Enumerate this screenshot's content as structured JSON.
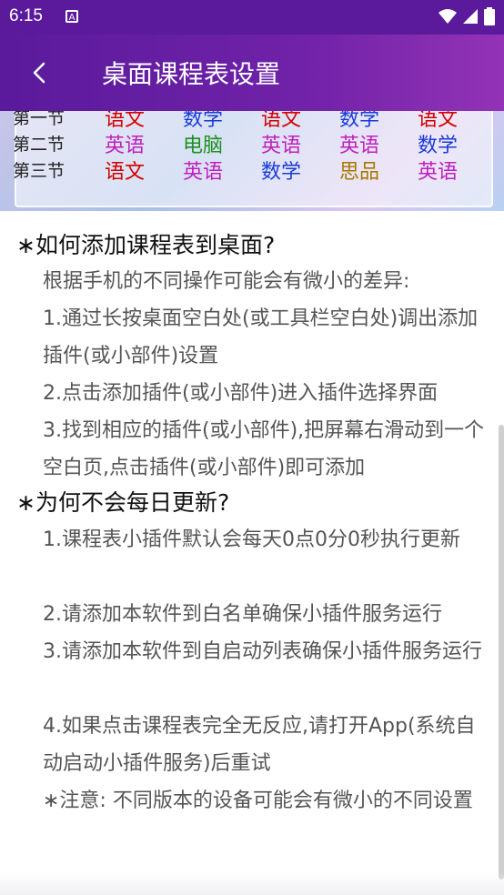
{
  "status_bar": {
    "time": "6:15",
    "notification_icon": "A",
    "wifi_icon": "wifi-icon",
    "signal_icon": "signal-icon",
    "battery_icon": "battery-icon"
  },
  "app_bar": {
    "title": "桌面课程表设置",
    "back_icon": "chevron-left-icon"
  },
  "preview": {
    "rows": [
      {
        "period": "第一节",
        "cells": [
          {
            "text": "语文",
            "color": "#d40000"
          },
          {
            "text": "数学",
            "color": "#1a3ad8"
          },
          {
            "text": "语文",
            "color": "#d40000"
          },
          {
            "text": "数学",
            "color": "#1a3ad8"
          },
          {
            "text": "语文",
            "color": "#d40000"
          }
        ]
      },
      {
        "period": "第二节",
        "cells": [
          {
            "text": "英语",
            "color": "#c11fbf"
          },
          {
            "text": "电脑",
            "color": "#1e8f1e"
          },
          {
            "text": "英语",
            "color": "#c11fbf"
          },
          {
            "text": "英语",
            "color": "#c11fbf"
          },
          {
            "text": "数学",
            "color": "#1a3ad8"
          }
        ]
      },
      {
        "period": "第三节",
        "cells": [
          {
            "text": "语文",
            "color": "#d40000"
          },
          {
            "text": "英语",
            "color": "#c11fbf"
          },
          {
            "text": "数学",
            "color": "#1a3ad8"
          },
          {
            "text": "思品",
            "color": "#a87800"
          },
          {
            "text": "英语",
            "color": "#c11fbf"
          }
        ]
      }
    ]
  },
  "faq": [
    {
      "question": "∗如何添加课程表到桌面?",
      "lines": [
        "根据手机的不同操作可能会有微小的差异:",
        "1.通过长按桌面空白处(或工具栏空白处)调出添加插件(或小部件)设置",
        "2.点击添加插件(或小部件)进入插件选择界面",
        "3.找到相应的插件(或小部件),把屏幕右滑动到一个空白页,点击插件(或小部件)即可添加"
      ]
    },
    {
      "question": "∗为何不会每日更新?",
      "lines": [
        "1.课程表小插件默认会每天0点0分0秒执行更新",
        "2.请添加本软件到白名单确保小插件服务运行",
        "3.请添加本软件到自启动列表确保小插件服务运行",
        "4.如果点击课程表完全无反应,请打开App(系统自动启动小插件服务)后重试",
        "∗注意: 不同版本的设备可能会有微小的不同设置"
      ]
    }
  ]
}
